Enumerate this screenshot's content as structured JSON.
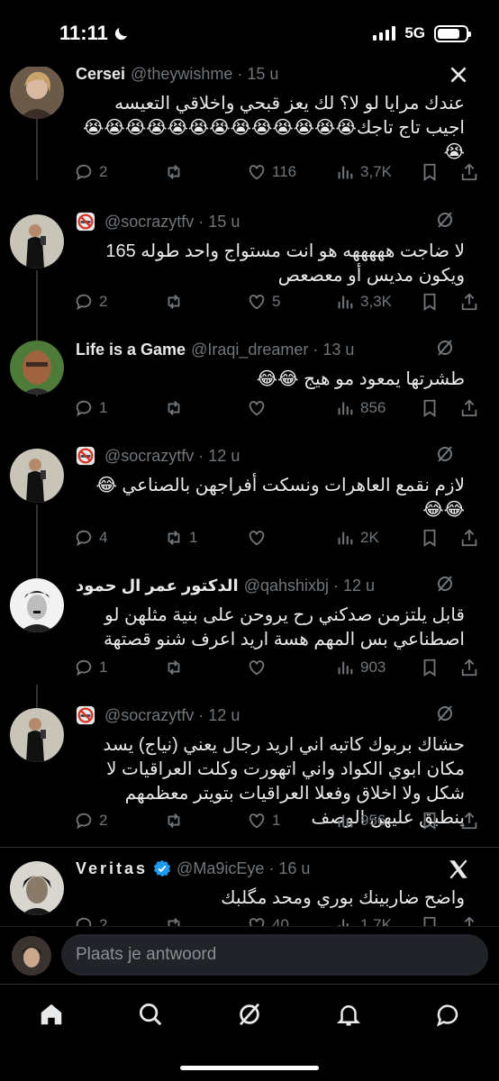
{
  "status_bar": {
    "time": "11:11",
    "network": "5G"
  },
  "tweets": [
    {
      "name": "Cersei",
      "handle": "@theywishme",
      "time": "15 u",
      "text": "عندك مرايا لو لا؟ لك يعز قبحي واخلاقي التعيسه اجيب تاج تاجك😭😭😭😭😭😭😭😭😭😭😭😭😭😭",
      "replies": "2",
      "retweets": "",
      "likes": "116",
      "views": "3,7K"
    },
    {
      "name": "",
      "handle": "@socrazytfv",
      "time": "15 u",
      "text": "لا ضاجت هههههه هو انت مستواج واحد طوله 165 ويكون مديس أو معصعص",
      "replies": "2",
      "retweets": "",
      "likes": "5",
      "views": "3,3K"
    },
    {
      "name": "Life is a Game",
      "handle": "@Iraqi_dreamer",
      "time": "13 u",
      "text": "طشرتها يمعود مو هيج 😂😂",
      "replies": "1",
      "retweets": "",
      "likes": "",
      "views": "856"
    },
    {
      "name": "",
      "handle": "@socrazytfv",
      "time": "12 u",
      "text": "لازم نقمع العاهرات ونسكت أفراجهن بالصناعي 😂😂😂",
      "replies": "4",
      "retweets": "1",
      "likes": "",
      "views": "2K"
    },
    {
      "name": "الدكتور عمر ال حمود",
      "handle": "@qahshixbj",
      "time": "12 u",
      "text": "قابل يلتزمن صدكني رح يروحن على بنية مثلهن لو اصطناعي بس المهم هسة اريد اعرف شنو قصتهة",
      "replies": "1",
      "retweets": "",
      "likes": "",
      "views": "903"
    },
    {
      "name": "",
      "handle": "@socrazytfv",
      "time": "12 u",
      "text": "حشاك بربوك كاتبه اني اريد رجال يعني (نياج) يسد مكان ابوي الكواد واني اتهورت وكلت العراقيات لا شكل ولا اخلاق وفعلا العراقيات بتويتر معظمهم ينطبق عليهن الوصف",
      "replies": "2",
      "retweets": "",
      "likes": "1",
      "views": "956"
    },
    {
      "name": "Veritas",
      "handle": "@Ma9icEye",
      "time": "16 u",
      "text": "واضح ضاربينك بوري ومحد مگلبك",
      "replies": "2",
      "retweets": "",
      "likes": "40",
      "views": "1,7K"
    }
  ],
  "reply_bar": {
    "placeholder": "Plaats je antwoord"
  },
  "tabs": [
    "home-icon",
    "search-icon",
    "grok-icon",
    "notifications-icon",
    "messages-icon"
  ],
  "colors": {
    "background": "#000000",
    "text": "#e7e9ea",
    "muted": "#71767b",
    "verified": "#1d9bf0",
    "divider": "#2f3336"
  }
}
